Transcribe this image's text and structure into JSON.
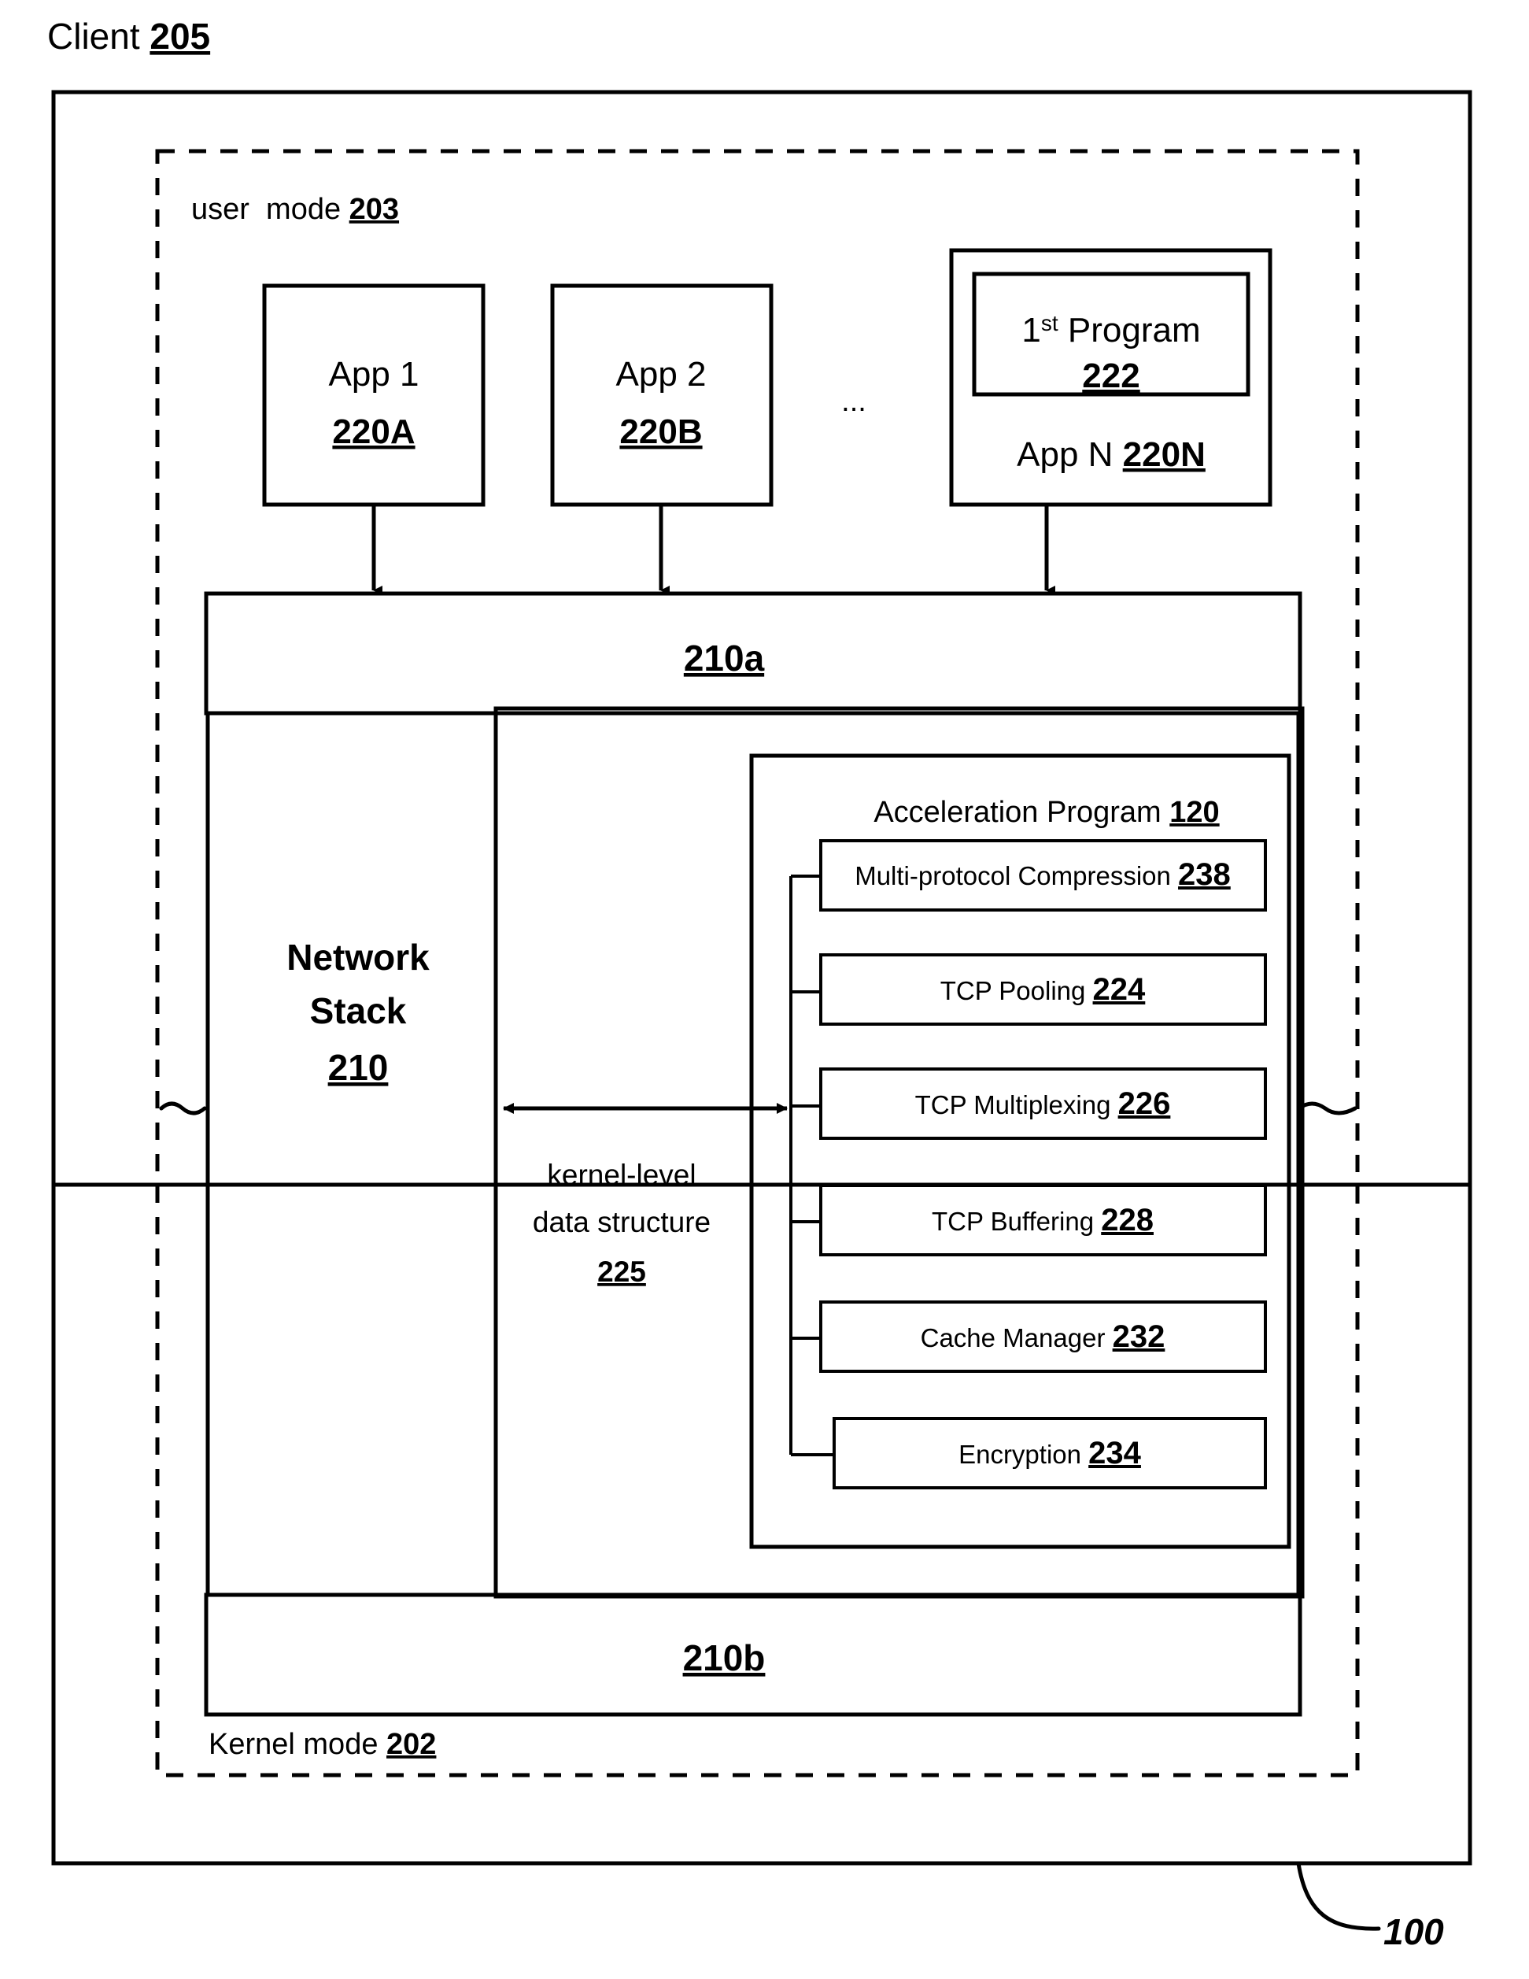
{
  "figure": {
    "title_label": "Client",
    "title_ref": "205",
    "figure_number": "100"
  },
  "modes": {
    "user_mode_label": "user  mode",
    "user_mode_ref": "203",
    "kernel_mode_label": "Kernel mode",
    "kernel_mode_ref": "202"
  },
  "apps": [
    {
      "name": "App 1",
      "ref": "220A"
    },
    {
      "name": "App 2",
      "ref": "220B"
    }
  ],
  "ellipsis": "...",
  "app_n": {
    "inner_program_label": "1st Program",
    "inner_program_sup": "st",
    "inner_program_prefix": "1",
    "inner_program_word": "Program",
    "inner_program_ref": "222",
    "name": "App N",
    "ref": "220N"
  },
  "network_stack": {
    "line1": "Network",
    "line2": "Stack",
    "ref": "210",
    "upper_ref": "210a",
    "lower_ref": "210b"
  },
  "kernel_data_structure": {
    "line1": "kernel-level",
    "line2": "data structure",
    "ref": "225"
  },
  "acceleration_program": {
    "title": "Acceleration Program",
    "ref": "120",
    "components": [
      {
        "label": "Multi-protocol Compression",
        "ref": "238"
      },
      {
        "label": "TCP Pooling",
        "ref": "224"
      },
      {
        "label": "TCP Multiplexing",
        "ref": "226"
      },
      {
        "label": "TCP Buffering",
        "ref": "228"
      },
      {
        "label": "Cache Manager",
        "ref": "232"
      },
      {
        "label": "Encryption",
        "ref": "234"
      }
    ]
  },
  "colors": {
    "stroke": "#000000",
    "background": "#ffffff"
  }
}
